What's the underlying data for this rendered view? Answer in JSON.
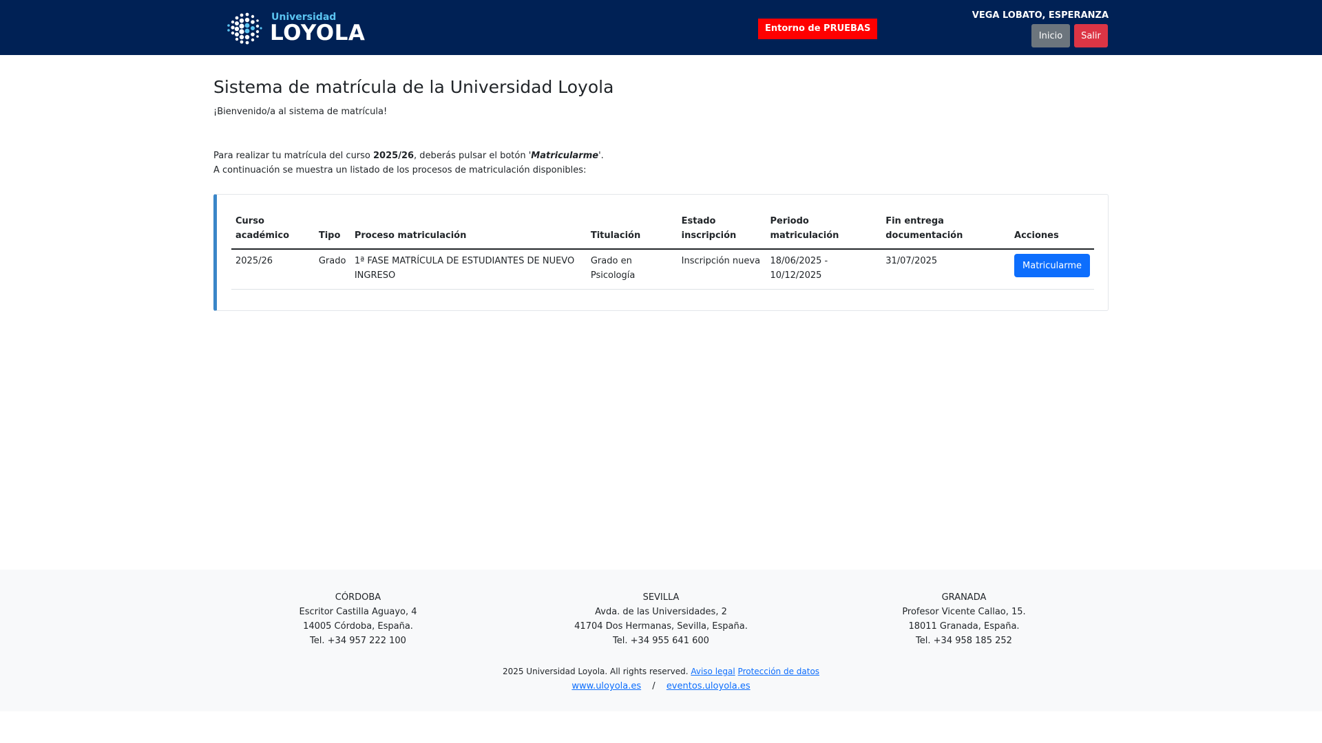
{
  "header": {
    "logo_small": "Universidad",
    "logo_big": "LOYOLA",
    "env_badge": "Entorno de PRUEBAS",
    "user_name": "VEGA LOBATO, ESPERANZA",
    "inicio_label": "Inicio",
    "salir_label": "Salir",
    "bg_color": "#002155",
    "accent_color": "#5bc4f1"
  },
  "main": {
    "title": "Sistema de matrícula de la Universidad Loyola",
    "welcome": "¡Bienvenido/a al sistema de matrícula!",
    "intro": {
      "part1": "Para realizar tu matrícula del curso ",
      "course": "2025/26",
      "part2": ", deberás pulsar el botón '",
      "button_ref": "Matricularme",
      "part3": "'."
    },
    "intro_line2": "A continuación se muestra un listado de los procesos de matriculación disponibles:"
  },
  "table": {
    "headers": {
      "curso": "Curso académico",
      "tipo": "Tipo",
      "proceso": "Proceso matriculación",
      "titulacion": "Titulación",
      "estado": "Estado inscripción",
      "periodo": "Periodo matriculación",
      "fin": "Fin entrega documentación",
      "acciones": "Acciones"
    },
    "rows": [
      {
        "curso": "2025/26",
        "tipo": "Grado",
        "proceso": "1ª FASE MATRÍCULA DE ESTUDIANTES DE NUEVO INGRESO",
        "titulacion": "Grado en Psicología",
        "estado": "Inscripción nueva",
        "periodo": "18/06/2025 - 10/12/2025",
        "fin": "31/07/2025",
        "action_label": "Matricularme"
      }
    ]
  },
  "footer": {
    "campuses": [
      {
        "name": "CÓRDOBA",
        "line1": "Escritor Castilla Aguayo, 4",
        "line2": "14005 Córdoba, España.",
        "phone": "Tel. +34 957 222 100"
      },
      {
        "name": "SEVILLA",
        "line1": "Avda. de las Universidades, 2",
        "line2": "41704 Dos Hermanas, Sevilla, España.",
        "phone": "Tel. +34 955 641 600"
      },
      {
        "name": "GRANADA",
        "line1": "Profesor Vicente Callao, 15.",
        "line2": "18011 Granada, España.",
        "phone": "Tel. +34 958 185 252"
      }
    ],
    "copyright": "2025 Universidad Loyola. All rights reserved.",
    "aviso_legal": "Aviso legal",
    "proteccion": "Protección de datos",
    "link_web": "www.uloyola.es",
    "separator": "/",
    "link_eventos": "eventos.uloyola.es"
  }
}
